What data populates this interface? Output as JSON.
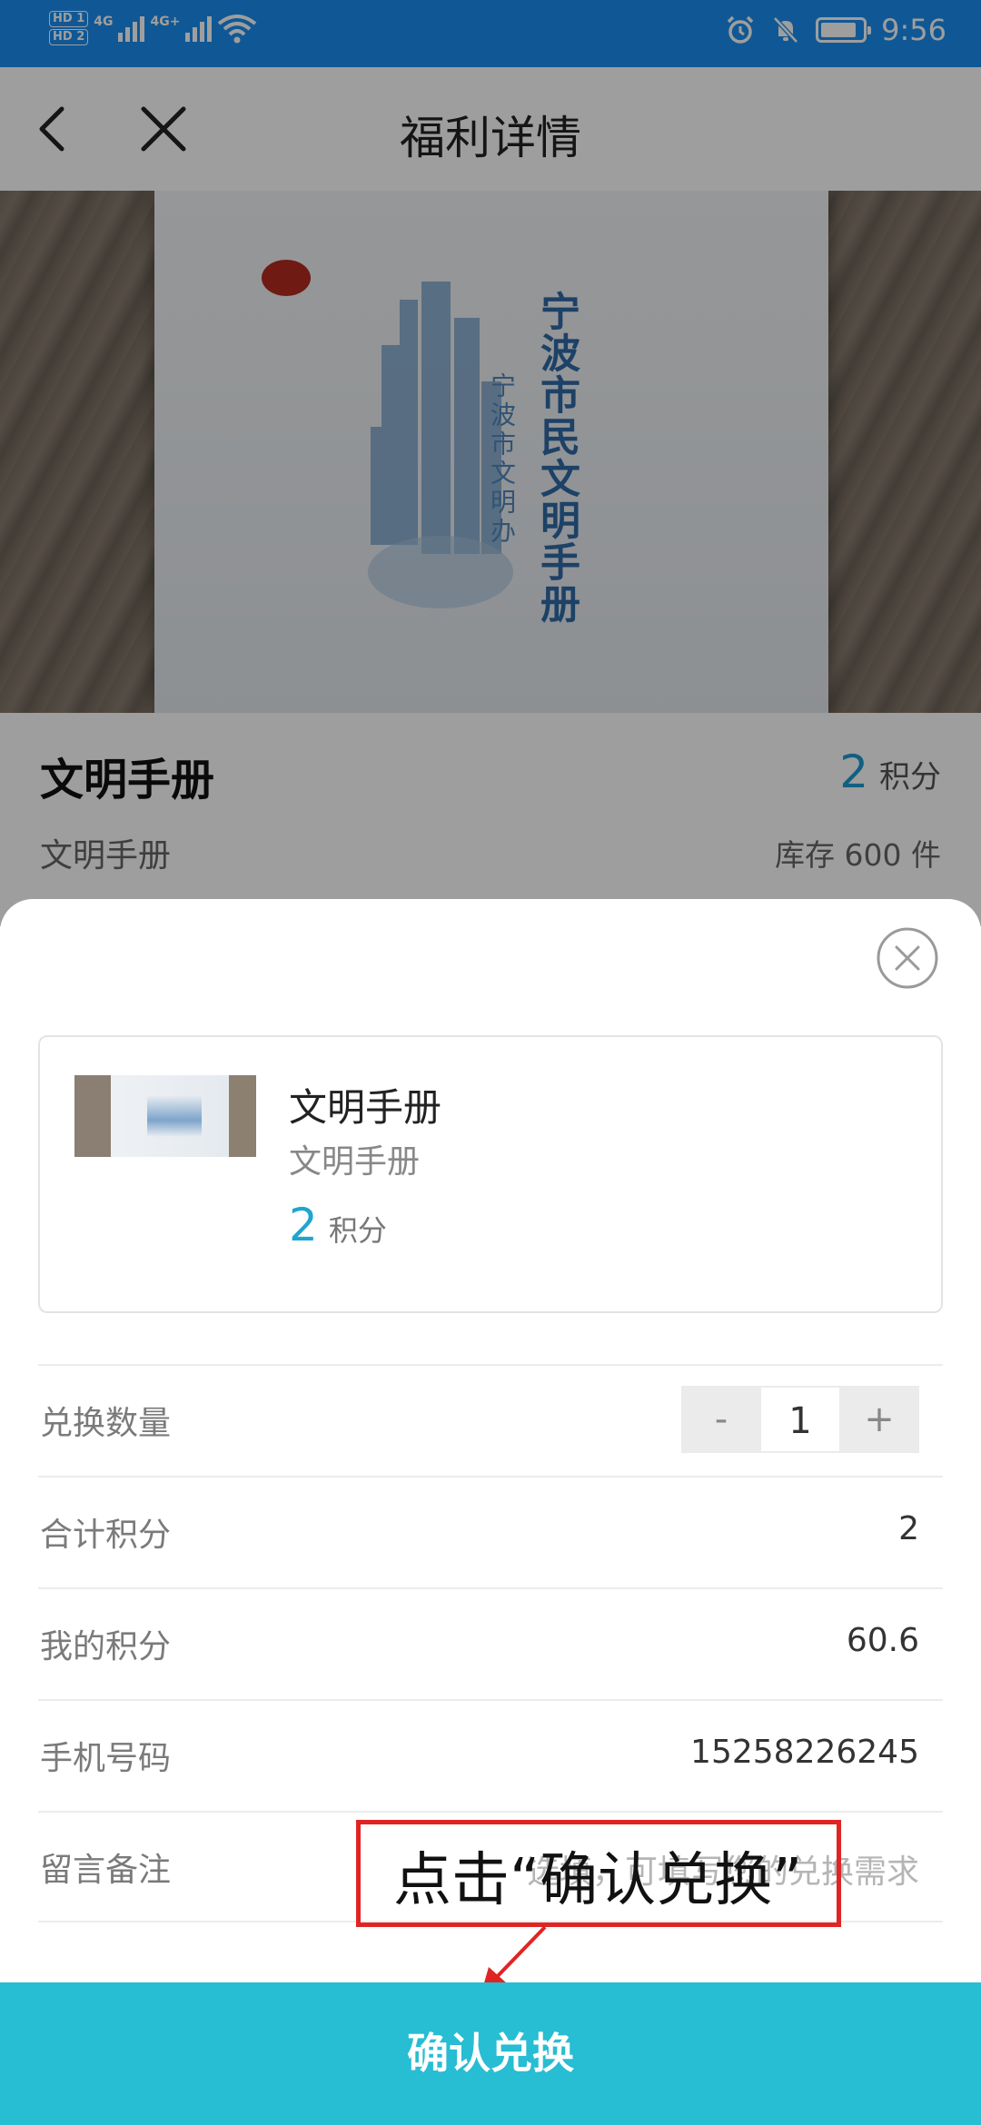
{
  "status_bar": {
    "hd1": "HD 1",
    "hd2": "HD 2",
    "net1": "4G",
    "net2": "4G+",
    "time": "9:56",
    "background_color": "#1a8ef0",
    "icons": [
      "signal-icon",
      "wifi-icon",
      "alarm-icon",
      "mute-icon",
      "battery-icon"
    ]
  },
  "nav": {
    "title": "福利详情",
    "back_icon": "chevron-left-icon",
    "close_icon": "close-icon"
  },
  "hero": {
    "book_title": "宁波市民文明手册",
    "book_subtitle": "宁波市文明办"
  },
  "detail": {
    "name": "文明手册",
    "points_value": "2",
    "points_unit": "积分",
    "description": "文明手册",
    "stock": "库存 600 件"
  },
  "sheet": {
    "close_icon": "circle-close-icon",
    "product": {
      "name": "文明手册",
      "description": "文明手册",
      "points_value": "2",
      "points_unit": "积分"
    },
    "rows": {
      "quantity": {
        "label": "兑换数量",
        "minus": "-",
        "value": "1",
        "plus": "+"
      },
      "total": {
        "label": "合计积分",
        "value": "2"
      },
      "mine": {
        "label": "我的积分",
        "value": "60.6"
      },
      "phone": {
        "label": "手机号码",
        "value": "15258226245"
      },
      "note": {
        "label": "留言备注",
        "placeholder": "选填，可填写您的兑换需求"
      }
    }
  },
  "annotation": {
    "text": "点击“确认兑换”",
    "color": "#e02424"
  },
  "confirm": {
    "label": "确认兑换",
    "color": "#27bdd2"
  }
}
